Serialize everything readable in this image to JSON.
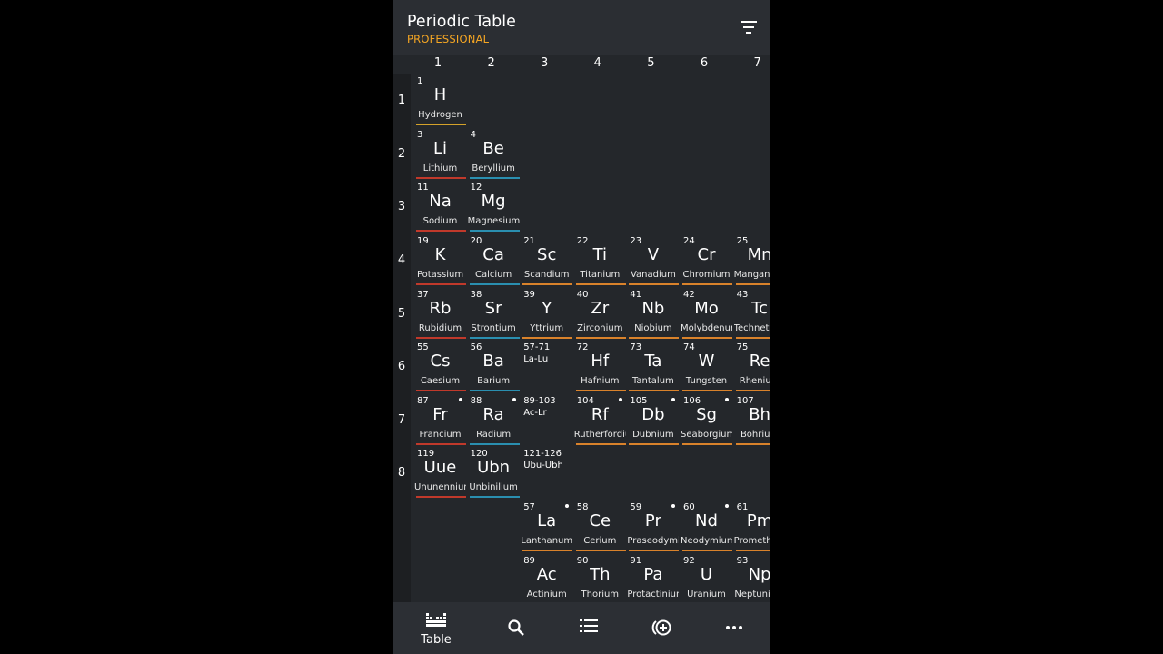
{
  "app": {
    "title": "Periodic Table",
    "subtitle": "PROFESSIONAL"
  },
  "colors": {
    "hydrogen": "#d4a22a",
    "alkali": "#c0392b",
    "alkaline": "#2a8fb0",
    "transition": "#d9822b",
    "lanthanide": "#d9822b",
    "actinide": "#d9822b",
    "accent": "#f5a623"
  },
  "columns": [
    "1",
    "2",
    "3",
    "4",
    "5",
    "6",
    "7"
  ],
  "rows": [
    "1",
    "2",
    "3",
    "4",
    "5",
    "6",
    "7",
    "8"
  ],
  "elements": [
    {
      "num": "1",
      "sym": "H",
      "name": "Hydrogen",
      "cat": "hydrogen",
      "row": 0,
      "col": 0
    },
    {
      "num": "3",
      "sym": "Li",
      "name": "Lithium",
      "cat": "alkali",
      "row": 1,
      "col": 0
    },
    {
      "num": "4",
      "sym": "Be",
      "name": "Beryllium",
      "cat": "alkaline",
      "row": 1,
      "col": 1
    },
    {
      "num": "11",
      "sym": "Na",
      "name": "Sodium",
      "cat": "alkali",
      "row": 2,
      "col": 0
    },
    {
      "num": "12",
      "sym": "Mg",
      "name": "Magnesium",
      "cat": "alkaline",
      "row": 2,
      "col": 1
    },
    {
      "num": "19",
      "sym": "K",
      "name": "Potassium",
      "cat": "alkali",
      "row": 3,
      "col": 0
    },
    {
      "num": "20",
      "sym": "Ca",
      "name": "Calcium",
      "cat": "alkaline",
      "row": 3,
      "col": 1
    },
    {
      "num": "21",
      "sym": "Sc",
      "name": "Scandium",
      "cat": "transition",
      "row": 3,
      "col": 2
    },
    {
      "num": "22",
      "sym": "Ti",
      "name": "Titanium",
      "cat": "transition",
      "row": 3,
      "col": 3
    },
    {
      "num": "23",
      "sym": "V",
      "name": "Vanadium",
      "cat": "transition",
      "row": 3,
      "col": 4
    },
    {
      "num": "24",
      "sym": "Cr",
      "name": "Chromium",
      "cat": "transition",
      "row": 3,
      "col": 5
    },
    {
      "num": "25",
      "sym": "Mn",
      "name": "Manganese",
      "cat": "transition",
      "row": 3,
      "col": 6
    },
    {
      "num": "37",
      "sym": "Rb",
      "name": "Rubidium",
      "cat": "alkali",
      "row": 4,
      "col": 0
    },
    {
      "num": "38",
      "sym": "Sr",
      "name": "Strontium",
      "cat": "alkaline",
      "row": 4,
      "col": 1
    },
    {
      "num": "39",
      "sym": "Y",
      "name": "Yttrium",
      "cat": "transition",
      "row": 4,
      "col": 2
    },
    {
      "num": "40",
      "sym": "Zr",
      "name": "Zirconium",
      "cat": "transition",
      "row": 4,
      "col": 3
    },
    {
      "num": "41",
      "sym": "Nb",
      "name": "Niobium",
      "cat": "transition",
      "row": 4,
      "col": 4
    },
    {
      "num": "42",
      "sym": "Mo",
      "name": "Molybdenum",
      "cat": "transition",
      "row": 4,
      "col": 5
    },
    {
      "num": "43",
      "sym": "Tc",
      "name": "Technetium",
      "cat": "transition",
      "row": 4,
      "col": 6
    },
    {
      "num": "55",
      "sym": "Cs",
      "name": "Caesium",
      "cat": "alkali",
      "row": 5,
      "col": 0
    },
    {
      "num": "56",
      "sym": "Ba",
      "name": "Barium",
      "cat": "alkaline",
      "row": 5,
      "col": 1
    },
    {
      "num": "72",
      "sym": "Hf",
      "name": "Hafnium",
      "cat": "transition",
      "row": 5,
      "col": 3
    },
    {
      "num": "73",
      "sym": "Ta",
      "name": "Tantalum",
      "cat": "transition",
      "row": 5,
      "col": 4
    },
    {
      "num": "74",
      "sym": "W",
      "name": "Tungsten",
      "cat": "transition",
      "row": 5,
      "col": 5
    },
    {
      "num": "75",
      "sym": "Re",
      "name": "Rhenium",
      "cat": "transition",
      "row": 5,
      "col": 6
    },
    {
      "num": "87",
      "sym": "Fr",
      "name": "Francium",
      "cat": "alkali",
      "row": 6,
      "col": 0,
      "dot": true
    },
    {
      "num": "88",
      "sym": "Ra",
      "name": "Radium",
      "cat": "alkaline",
      "row": 6,
      "col": 1,
      "dot": true
    },
    {
      "num": "104",
      "sym": "Rf",
      "name": "Rutherfordium",
      "cat": "transition",
      "row": 6,
      "col": 3,
      "dot": true
    },
    {
      "num": "105",
      "sym": "Db",
      "name": "Dubnium",
      "cat": "transition",
      "row": 6,
      "col": 4,
      "dot": true
    },
    {
      "num": "106",
      "sym": "Sg",
      "name": "Seaborgium",
      "cat": "transition",
      "row": 6,
      "col": 5,
      "dot": true
    },
    {
      "num": "107",
      "sym": "Bh",
      "name": "Bohrium",
      "cat": "transition",
      "row": 6,
      "col": 6
    },
    {
      "num": "119",
      "sym": "Uue",
      "name": "Ununennium",
      "cat": "alkali",
      "row": 7,
      "col": 0
    },
    {
      "num": "120",
      "sym": "Ubn",
      "name": "Unbinilium",
      "cat": "alkaline",
      "row": 7,
      "col": 1
    },
    {
      "num": "57",
      "sym": "La",
      "name": "Lanthanum",
      "cat": "lanthanide",
      "row": 8,
      "col": 2,
      "dot": true
    },
    {
      "num": "58",
      "sym": "Ce",
      "name": "Cerium",
      "cat": "lanthanide",
      "row": 8,
      "col": 3
    },
    {
      "num": "59",
      "sym": "Pr",
      "name": "Praseodymium",
      "cat": "lanthanide",
      "row": 8,
      "col": 4,
      "dot": true
    },
    {
      "num": "60",
      "sym": "Nd",
      "name": "Neodymium",
      "cat": "lanthanide",
      "row": 8,
      "col": 5,
      "dot": true
    },
    {
      "num": "61",
      "sym": "Pm",
      "name": "Promethium",
      "cat": "lanthanide",
      "row": 8,
      "col": 6
    },
    {
      "num": "89",
      "sym": "Ac",
      "name": "Actinium",
      "cat": "actinide",
      "row": 9,
      "col": 2
    },
    {
      "num": "90",
      "sym": "Th",
      "name": "Thorium",
      "cat": "actinide",
      "row": 9,
      "col": 3
    },
    {
      "num": "91",
      "sym": "Pa",
      "name": "Protactinium",
      "cat": "actinide",
      "row": 9,
      "col": 4
    },
    {
      "num": "92",
      "sym": "U",
      "name": "Uranium",
      "cat": "actinide",
      "row": 9,
      "col": 5
    },
    {
      "num": "93",
      "sym": "Np",
      "name": "Neptunium",
      "cat": "actinide",
      "row": 9,
      "col": 6
    }
  ],
  "series_refs": [
    {
      "num": "57-71",
      "range": "La-Lu",
      "row": 5,
      "col": 2
    },
    {
      "num": "89-103",
      "range": "Ac-Lr",
      "row": 6,
      "col": 2
    },
    {
      "num": "121-126",
      "range": "Ubu-Ubh",
      "row": 7,
      "col": 2
    }
  ],
  "nav": {
    "table_label": "Table",
    "items": [
      "table-icon",
      "search-icon",
      "list-icon",
      "add-circle-icon",
      "more-icon"
    ]
  }
}
